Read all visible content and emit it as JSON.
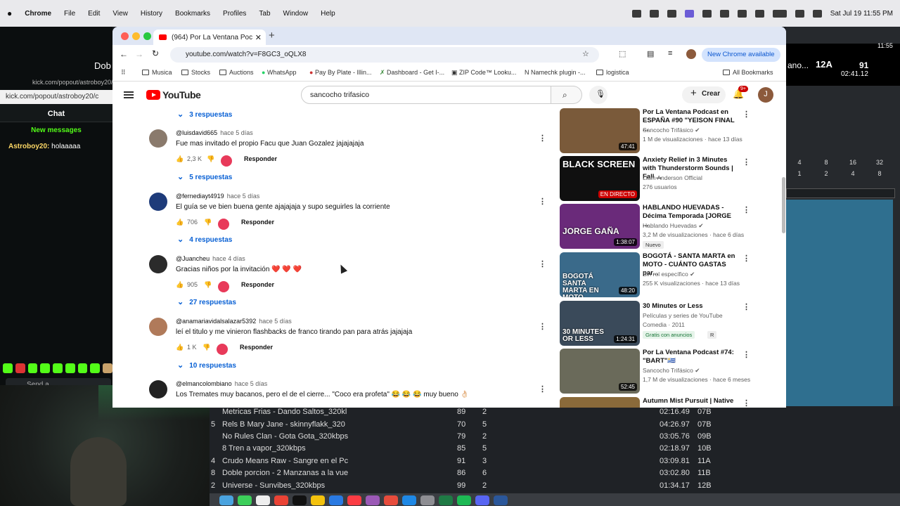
{
  "menubar": {
    "app": "Chrome",
    "items": [
      "File",
      "Edit",
      "View",
      "History",
      "Bookmarks",
      "Profiles",
      "Tab",
      "Window",
      "Help"
    ],
    "clock": "Sat Jul 19  11:55 PM"
  },
  "kick": {
    "url": "kick.com/popout/astroboy20/c",
    "url_bg": "kick.com/popout/astroboy20/",
    "chat_title": "Chat",
    "new_messages": "New messages",
    "message_user": "Astroboy20:",
    "message_text": "holaaaaa",
    "send_placeholder": "Send a"
  },
  "dj": {
    "bpm": "12A",
    "time": "02:41.12",
    "num": "91",
    "clock": "11:55",
    "label1": "Dob",
    "label2": "ano...",
    "loops": [
      "4",
      "8",
      "16",
      "32",
      "1",
      "2",
      "4",
      "8"
    ]
  },
  "tracklist": [
    {
      "idx": "",
      "title": "Metricas Frias - Dando Saltos_320kl",
      "bpm": "89",
      "c": "2",
      "time": "02:16.49",
      "key": "07B"
    },
    {
      "idx": "5",
      "title": "Rels B  Mary Jane - skinnyflakk_320",
      "bpm": "70",
      "c": "5",
      "time": "04:26.97",
      "key": "07B"
    },
    {
      "idx": "",
      "title": "No Rules Clan - Gota Gota_320kbps",
      "bpm": "79",
      "c": "2",
      "time": "03:05.76",
      "key": "09B"
    },
    {
      "idx": "",
      "title": "8 Tren a vapor_320kbps",
      "bpm": "85",
      "c": "5",
      "time": "02:18.97",
      "key": "10B"
    },
    {
      "idx": "4",
      "title": "Crudo Means Raw - Sangre en el Pc",
      "bpm": "91",
      "c": "3",
      "time": "03:09.81",
      "key": "11A"
    },
    {
      "idx": "8",
      "title": "Doble porcion - 2 Manzanas a la vue",
      "bpm": "86",
      "c": "6",
      "time": "03:02.80",
      "key": "11B"
    },
    {
      "idx": "2",
      "title": "Universe - Sunvibes_320kbps",
      "bpm": "99",
      "c": "2",
      "time": "01:34.17",
      "key": "12B"
    }
  ],
  "browser": {
    "tab_title": "(964) Por La Ventana Poc",
    "url": "youtube.com/watch?v=F8GC3_oQLX8",
    "update_label": "New Chrome available",
    "bookmarks": [
      "Musica",
      "Stocks",
      "Auctions",
      "WhatsApp",
      "Pay By Plate - Illin...",
      "Dashboard - Get I-...",
      "ZIP Code™ Looku...",
      "Namechk plugin -...",
      "logistica"
    ],
    "all_bookmarks": "All Bookmarks"
  },
  "youtube": {
    "logo": "YouTube",
    "search_value": "sancocho trifasico",
    "create_label": "Crear",
    "notif_count": "9+",
    "avatar_letter": "J"
  },
  "comments": {
    "first_replies": "3 respuestas",
    "reply_label": "Responder",
    "items": [
      {
        "author": "@luisdavid665",
        "time": "hace 5 días",
        "text": "Fue mas invitado el propio Facu que Juan Gozalez jajajajaja",
        "likes": "2,3 K",
        "replies": "5 respuestas",
        "avatar_color": "#8a7a6c"
      },
      {
        "author": "@fernediayt4919",
        "time": "hace 5 días",
        "text": "El guía se ve bien buena gente ajajajaja y supo seguirles la corriente",
        "likes": "706",
        "replies": "4 respuestas",
        "avatar_color": "#1e3b7a"
      },
      {
        "author": "@Juancheu",
        "time": "hace 4 días",
        "text": "Gracias niños por la invitación ❤️ ❤️ ❤️",
        "likes": "905",
        "replies": "27 respuestas",
        "avatar_color": "#2b2b2b"
      },
      {
        "author": "@anamariavidalsalazar5392",
        "time": "hace 5 días",
        "text": "leí el titulo y me vinieron flashbacks de franco tirando pan para atrás jajajaja",
        "likes": "1 K",
        "replies": "10 respuestas",
        "avatar_color": "#b07a5a"
      },
      {
        "author": "@elmancolombiano",
        "time": "hace 5 días",
        "text": "Los Tremates muy bacanos, pero el de el cierre... \"Coco era profeta\" 😂 😂 😂 muy bueno 👌🏻",
        "likes": "",
        "replies": "",
        "avatar_color": "#222222"
      }
    ]
  },
  "sidebar": [
    {
      "title": "Por La Ventana Podcast en ESPAÑA #90 \"YEISON FINAL ...",
      "channel": "Sancocho Trifásico",
      "verified": true,
      "meta": "1 M de visualizaciones · hace 13 días",
      "duration": "47:41",
      "badge": "",
      "thumb": "#7a5a3a",
      "thumb_text": ""
    },
    {
      "title": "Anxiety Relief in 3 Minutes with Thunderstorm Sounds | Fall ...",
      "channel": "Liam Anderson Official",
      "verified": false,
      "meta": "276 usuarios",
      "duration": "EN DIRECTO",
      "badge": "",
      "thumb": "#101010",
      "thumb_text": "BLACK SCREEN"
    },
    {
      "title": "HABLANDO HUEVADAS - Décima Temporada [JORGE ...",
      "channel": "Hablando Huevadas",
      "verified": true,
      "meta": "3,2 M de visualizaciones · hace 6 días",
      "duration": "1:38:07",
      "badge": "Nuevo",
      "thumb": "#6a2a7a",
      "thumb_text": "JORGE GAÑA"
    },
    {
      "title": "BOGOTÁ - SANTA MARTA en MOTO - CUÁNTO GASTAS par...",
      "channel": "Sin rol específico",
      "verified": true,
      "meta": "255 K visualizaciones · hace 13 días",
      "duration": "48:20",
      "badge": "",
      "thumb": "#3a6a8a",
      "thumb_text": "BOGOTÁ SANTA MARTA EN MOTO"
    },
    {
      "title": "30 Minutes or Less",
      "channel": "Películas y series de YouTube",
      "verified": false,
      "meta": "Comedia · 2011",
      "duration": "1:24:31",
      "badge": "Gratis con anuncios",
      "badge2": "R",
      "thumb": "#3a4a5a",
      "thumb_text": "30 MINUTES OR LESS"
    },
    {
      "title": "Por La Ventana Podcast #74: \"BART\"🇺🇾",
      "channel": "Sancocho Trifásico",
      "verified": true,
      "meta": "1,7 M de visualizaciones · hace 6 meses",
      "duration": "52:45",
      "badge": "",
      "thumb": "#6a6a5a",
      "thumb_text": ""
    },
    {
      "title": "Autumn Mist Pursuit | Native",
      "channel": "",
      "verified": false,
      "meta": "",
      "duration": "",
      "badge": "",
      "thumb": "#8a6a3a",
      "thumb_text": ""
    }
  ]
}
